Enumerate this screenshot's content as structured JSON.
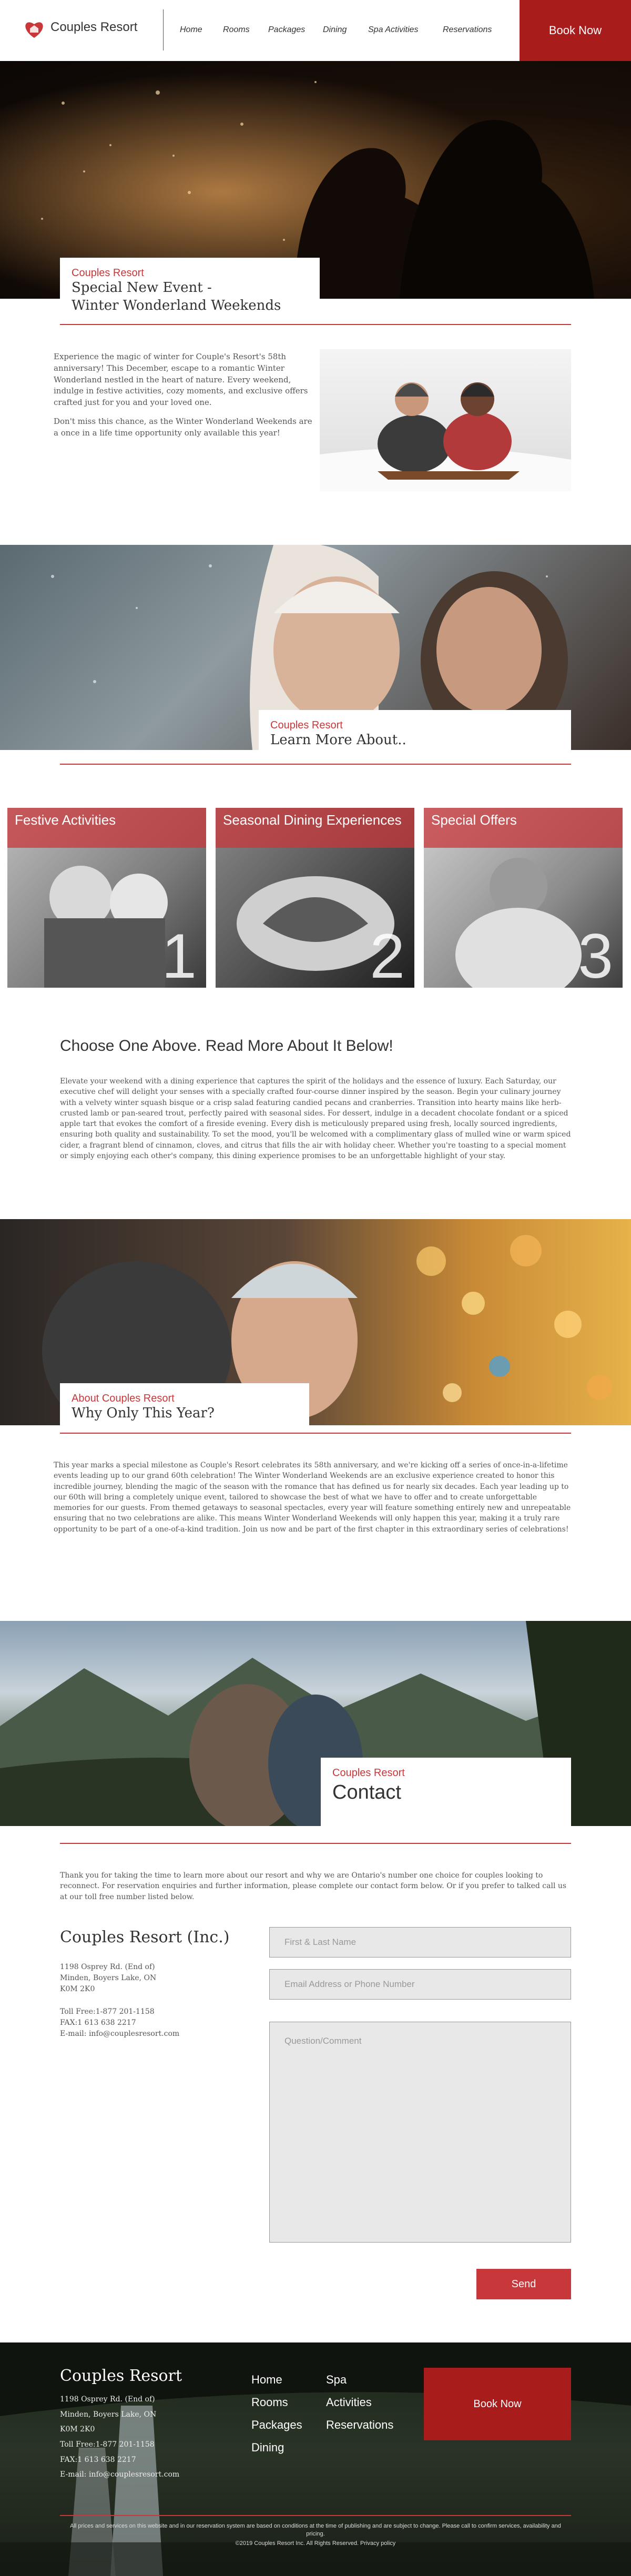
{
  "header": {
    "brand": "Couples Resort",
    "nav": [
      "Home",
      "Rooms",
      "Packages",
      "Dining",
      "Spa Activities",
      "Reservations"
    ],
    "book_now": "Book Now"
  },
  "event": {
    "kicker": "Couples Resort",
    "title_line1": "Special New Event -",
    "title_line2": "Winter Wonderland Weekends",
    "para1": "Experience the magic of winter for Couple's Resort's 58th anniversary! This December, escape to a romantic Winter Wonderland nestled in the heart of nature. Every weekend, indulge in festive activities, cozy moments, and exclusive offers crafted just for you and your loved one.",
    "para2": "Don't miss this chance, as the Winter Wonderland Weekends are a once in a life time opportunity only available this year!"
  },
  "learn": {
    "kicker": "Couples Resort",
    "title": "Learn More About.."
  },
  "categories": [
    {
      "label": "Festive Activities",
      "num": "1"
    },
    {
      "label": "Seasonal Dining Experiences",
      "num": "2"
    },
    {
      "label": "Special Offers",
      "num": "3"
    }
  ],
  "choose": {
    "heading": "Choose One Above. Read More About It Below!",
    "para": "Elevate your weekend with a dining experience that captures the spirit of the holidays and the essence of luxury. Each Saturday, our executive chef will delight your senses with a specially crafted four-course dinner inspired by the season. Begin your culinary journey with a velvety winter squash bisque or a crisp salad featuring candied pecans and cranberries. Transition into hearty mains like herb-crusted lamb or pan-seared trout, perfectly paired with seasonal sides. For dessert, indulge in a decadent chocolate fondant or a spiced apple tart that evokes the comfort of a fireside evening. Every dish is meticulously prepared using fresh, locally sourced ingredients, ensuring both quality and sustainability. To set the mood, you'll be welcomed with a complimentary glass of mulled wine or warm spiced cider, a fragrant blend of cinnamon, cloves, and citrus that fills the air with holiday cheer. Whether you're toasting to a special moment or simply enjoying each other's company, this dining experience promises to be an unforgettable highlight of your stay."
  },
  "about": {
    "kicker": "About Couples Resort",
    "title": "Why Only This Year?",
    "para": "This year marks a special milestone as Couple's Resort celebrates its 58th anniversary, and we're kicking off a series of once-in-a-lifetime events leading up to our grand 60th celebration! The Winter Wonderland Weekends are an exclusive experience created to honor this incredible journey, blending the magic of the season with the romance that has defined us for nearly six decades. Each year leading up to our 60th will bring a completely unique event, tailored to showcase the best of what we have to offer and to create unforgettable memories for our guests. From themed getaways to seasonal spectacles, every year will feature something entirely new and unrepeatable ensuring that no two celebrations are alike. This means Winter Wonderland Weekends will only happen this year, making it a truly rare opportunity to be part of a one-of-a-kind tradition. Join us now and be part of the first chapter in this extraordinary series of celebrations!"
  },
  "contact": {
    "kicker": "Couples Resort",
    "title": "Contact",
    "intro": "Thank you for taking the time to learn more about our resort and why we are Ontario's number one choice for couples looking to reconnect.  For reservation enquiries and further information, please complete our contact form below.  Or if you prefer to talked call us at our toll free number listed below.",
    "company": "Couples Resort (Inc.)",
    "address": [
      "1198 Osprey Rd. (End of)",
      "Minden, Boyers Lake, ON",
      "K0M 2K0"
    ],
    "phones": [
      "Toll Free:1-877 201-1158",
      "FAX:1 613 638 2217",
      "E-mail: info@couplesresort.com"
    ],
    "name_placeholder": "First & Last Name",
    "email_placeholder": "Email Address or Phone Number",
    "comment_placeholder": "Question/Comment",
    "send": "Send"
  },
  "footer": {
    "brand": "Couples Resort",
    "lines": [
      "1198 Osprey Rd. (End of)",
      "Minden, Boyers Lake, ON",
      "K0M 2K0",
      "Toll Free:1-877 201-1158",
      "FAX:1 613 638 2217",
      "E-mail: info@couplesresort.com"
    ],
    "links_col1": [
      "Home",
      "Rooms",
      "Packages",
      "Dining"
    ],
    "links_col2": [
      "Spa",
      "Activities",
      "Reservations"
    ],
    "book_now": "Book Now",
    "disclaimer": "All prices and services on this website and in our reservation system are based on conditions at the time of publishing and are subject to change. Please call to confirm services, availability and pricing.",
    "copyright": "©2019 Couples Resort Inc. All Rights Reserved. Privacy policy"
  }
}
